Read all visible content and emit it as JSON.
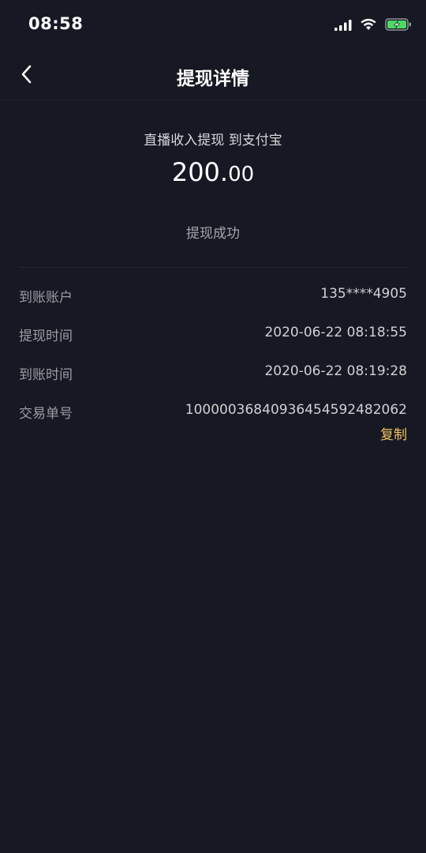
{
  "status_bar": {
    "time": "08:58",
    "icons": [
      "signal-icon",
      "wifi-icon",
      "battery-charging-icon"
    ]
  },
  "header": {
    "title": "提现详情",
    "back_icon": "chevron-left-icon"
  },
  "summary": {
    "description": "直播收入提现 到支付宝",
    "amount_int": "200.",
    "amount_dec": "00",
    "status": "提现成功"
  },
  "details": [
    {
      "label": "到账账户",
      "value": "135****4905"
    },
    {
      "label": "提现时间",
      "value": "2020-06-22 08:18:55"
    },
    {
      "label": "到账时间",
      "value": "2020-06-22 08:19:28"
    },
    {
      "label": "交易单号",
      "value": "10000036840936454592482062"
    }
  ],
  "copy_label": "复制",
  "colors": {
    "background": "#161823",
    "accent": "#f2c35a",
    "battery": "#4cd964"
  }
}
